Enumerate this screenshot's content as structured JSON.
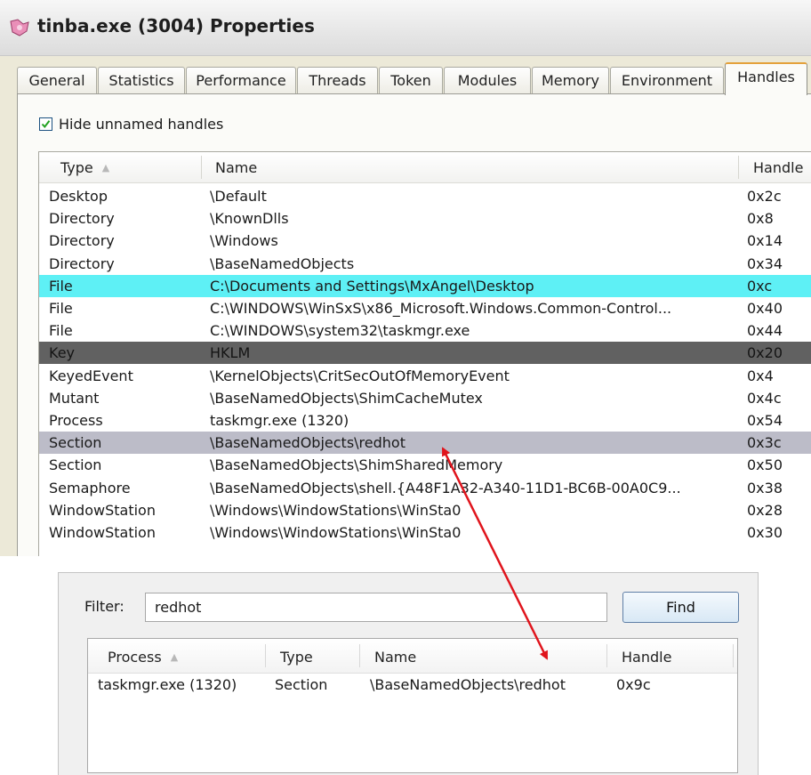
{
  "window": {
    "title": "tinba.exe (3004) Properties",
    "icon": "process-app-icon"
  },
  "tabs": [
    {
      "label": "General"
    },
    {
      "label": "Statistics"
    },
    {
      "label": "Performance"
    },
    {
      "label": "Threads"
    },
    {
      "label": "Token"
    },
    {
      "label": "Modules"
    },
    {
      "label": "Memory"
    },
    {
      "label": "Environment"
    },
    {
      "label": "Handles",
      "active": true
    }
  ],
  "handles_tab": {
    "hide_unnamed": {
      "label": "Hide unnamed handles",
      "checked": true
    },
    "columns": {
      "type": "Type",
      "name": "Name",
      "handle": "Handle"
    },
    "rows": [
      {
        "type": "Desktop",
        "name": "\\Default",
        "handle": "0x2c"
      },
      {
        "type": "Directory",
        "name": "\\KnownDlls",
        "handle": "0x8"
      },
      {
        "type": "Directory",
        "name": "\\Windows",
        "handle": "0x14"
      },
      {
        "type": "Directory",
        "name": "\\BaseNamedObjects",
        "handle": "0x34"
      },
      {
        "type": "File",
        "name": "C:\\Documents and Settings\\MxAngel\\Desktop",
        "handle": "0xc",
        "highlight": "cyan"
      },
      {
        "type": "File",
        "name": "C:\\WINDOWS\\WinSxS\\x86_Microsoft.Windows.Common-Control...",
        "handle": "0x40"
      },
      {
        "type": "File",
        "name": "C:\\WINDOWS\\system32\\taskmgr.exe",
        "handle": "0x44"
      },
      {
        "type": "Key",
        "name": "HKLM",
        "handle": "0x20",
        "highlight": "dark"
      },
      {
        "type": "KeyedEvent",
        "name": "\\KernelObjects\\CritSecOutOfMemoryEvent",
        "handle": "0x4"
      },
      {
        "type": "Mutant",
        "name": "\\BaseNamedObjects\\ShimCacheMutex",
        "handle": "0x4c"
      },
      {
        "type": "Process",
        "name": "taskmgr.exe (1320)",
        "handle": "0x54"
      },
      {
        "type": "Section",
        "name": "\\BaseNamedObjects\\redhot",
        "handle": "0x3c",
        "highlight": "gray"
      },
      {
        "type": "Section",
        "name": "\\BaseNamedObjects\\ShimSharedMemory",
        "handle": "0x50"
      },
      {
        "type": "Semaphore",
        "name": "\\BaseNamedObjects\\shell.{A48F1A32-A340-11D1-BC6B-00A0C9...",
        "handle": "0x38"
      },
      {
        "type": "WindowStation",
        "name": "\\Windows\\WindowStations\\WinSta0",
        "handle": "0x28"
      },
      {
        "type": "WindowStation",
        "name": "\\Windows\\WindowStations\\WinSta0",
        "handle": "0x30"
      }
    ]
  },
  "find_dialog": {
    "filter_label": "Filter:",
    "filter_value": "redhot",
    "find_button": "Find",
    "columns": {
      "process": "Process",
      "type": "Type",
      "name": "Name",
      "handle": "Handle"
    },
    "results": [
      {
        "process": "taskmgr.exe (1320)",
        "type": "Section",
        "name": "\\BaseNamedObjects\\redhot",
        "handle": "0x9c"
      }
    ]
  },
  "colors": {
    "highlight_cyan": "#5ef0f5",
    "highlight_dark": "#616161",
    "highlight_gray": "#bcbcc8",
    "annotation_arrow": "#e0141c",
    "active_tab_accent": "#e4a13a"
  }
}
